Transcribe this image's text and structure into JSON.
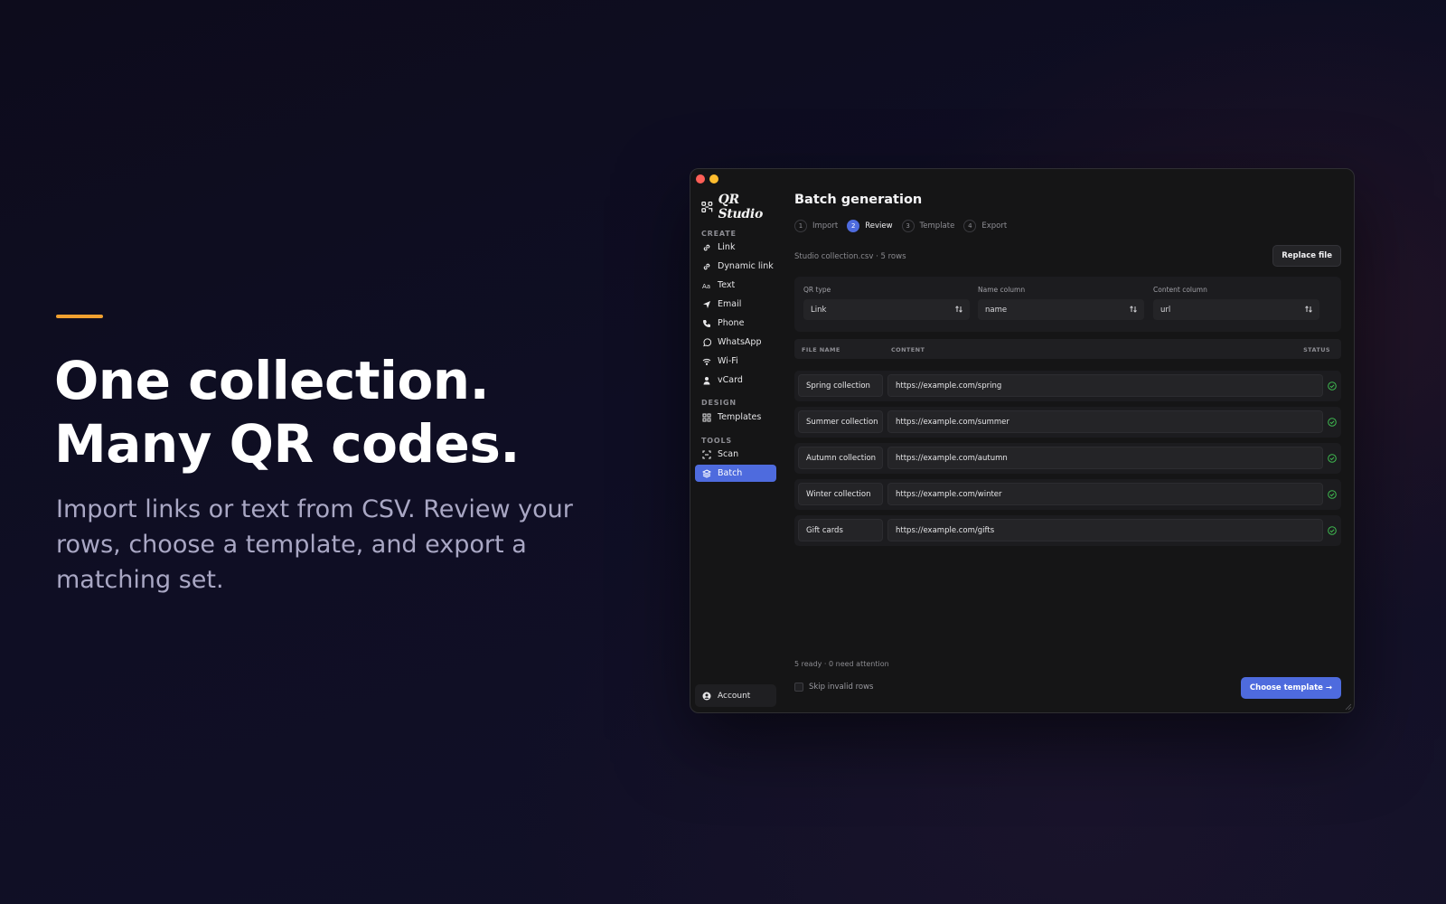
{
  "hero": {
    "title_line1": "One collection.",
    "title_line2": "Many QR codes.",
    "subtitle": "Import links or text from CSV. Review your rows, choose a template, and export a matching set.",
    "accent_color": "#f0a030"
  },
  "app": {
    "logo_text": "QR Studio",
    "sidebar": {
      "create_label": "CREATE",
      "create_items": [
        {
          "label": "Link",
          "icon": "link-icon"
        },
        {
          "label": "Dynamic link",
          "icon": "link-icon"
        },
        {
          "label": "Text",
          "icon": "text-icon"
        },
        {
          "label": "Email",
          "icon": "send-icon"
        },
        {
          "label": "Phone",
          "icon": "phone-icon"
        },
        {
          "label": "WhatsApp",
          "icon": "whatsapp-icon"
        },
        {
          "label": "Wi-Fi",
          "icon": "wifi-icon"
        },
        {
          "label": "vCard",
          "icon": "person-icon"
        }
      ],
      "design_label": "DESIGN",
      "design_items": [
        {
          "label": "Templates",
          "icon": "grid-icon"
        }
      ],
      "tools_label": "TOOLS",
      "tools_items": [
        {
          "label": "Scan",
          "icon": "scan-icon"
        },
        {
          "label": "Batch",
          "icon": "layers-icon",
          "active": true
        }
      ],
      "account_label": "Account"
    },
    "main": {
      "title": "Batch generation",
      "steps": [
        {
          "num": "1",
          "label": "Import"
        },
        {
          "num": "2",
          "label": "Review",
          "active": true
        },
        {
          "num": "3",
          "label": "Template"
        },
        {
          "num": "4",
          "label": "Export"
        }
      ],
      "file_info": "Studio collection.csv · 5 rows",
      "replace_button": "Replace file",
      "config": {
        "qr_type_label": "QR type",
        "qr_type_value": "Link",
        "name_column_label": "Name column",
        "name_column_value": "name",
        "content_column_label": "Content column",
        "content_column_value": "url"
      },
      "table": {
        "headers": {
          "file_name": "FILE NAME",
          "content": "CONTENT",
          "status": "STATUS"
        },
        "rows": [
          {
            "name": "Spring collection",
            "content": "https://example.com/spring",
            "status": "ok"
          },
          {
            "name": "Summer collection",
            "content": "https://example.com/summer",
            "status": "ok"
          },
          {
            "name": "Autumn collection",
            "content": "https://example.com/autumn",
            "status": "ok"
          },
          {
            "name": "Winter collection",
            "content": "https://example.com/winter",
            "status": "ok"
          },
          {
            "name": "Gift cards",
            "content": "https://example.com/gifts",
            "status": "ok"
          }
        ]
      },
      "summary": "5 ready · 0 need attention",
      "skip_label": "Skip invalid rows",
      "primary_button": "Choose template →"
    },
    "colors": {
      "accent_blue": "#4e6bde",
      "status_green": "#3fb950"
    }
  }
}
